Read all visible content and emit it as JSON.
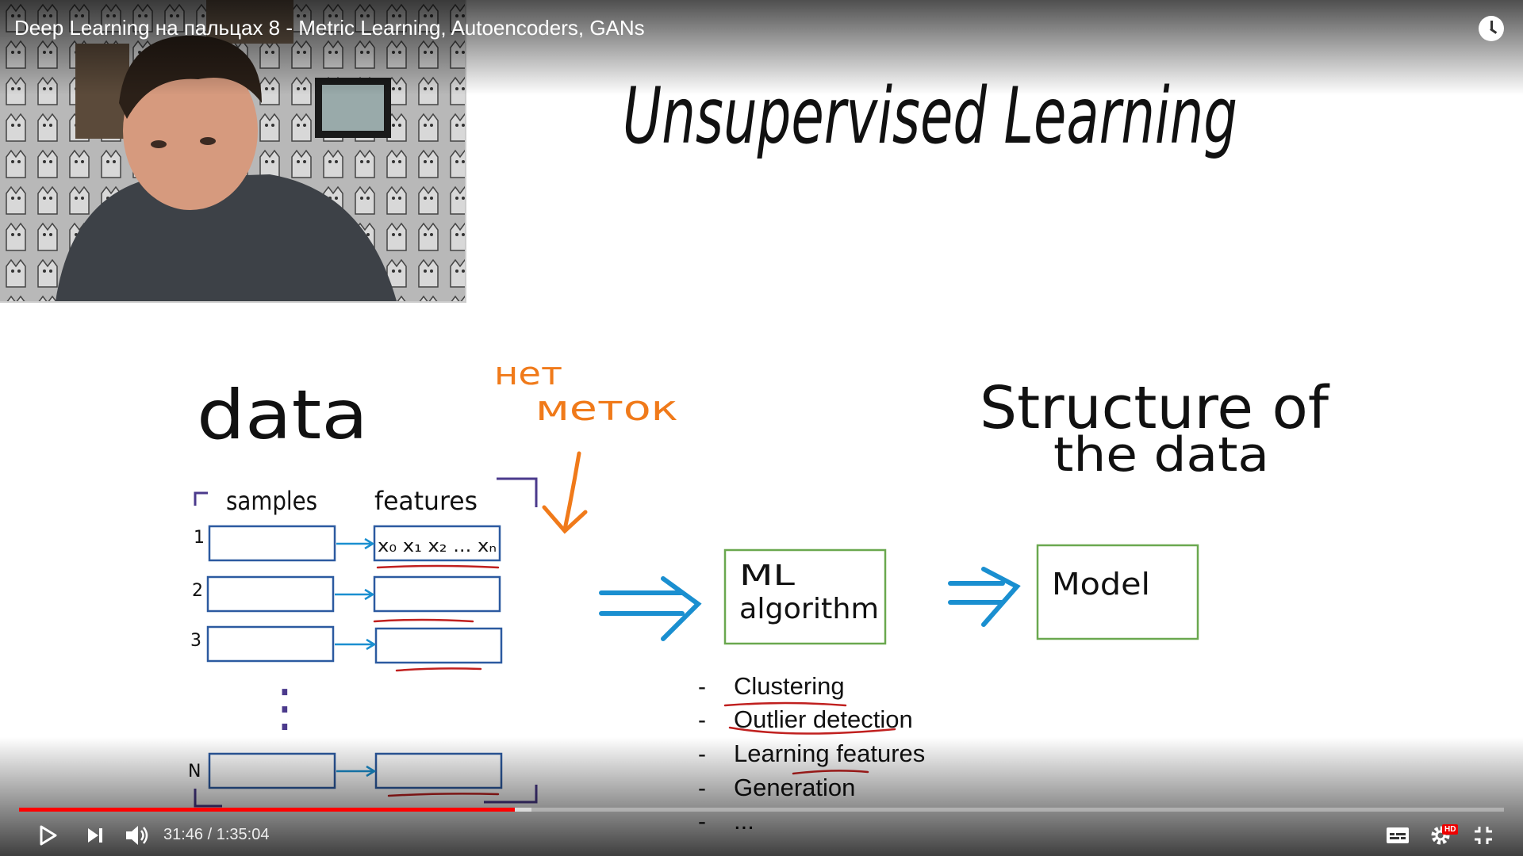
{
  "player": {
    "title": "Deep Learning на пальцах 8 - Metric Learning, Autoencoders, GANs",
    "current_time": "31:46",
    "duration": "1:35:04",
    "time_text": "31:46 / 1:35:04",
    "progress_fraction": 0.334,
    "buffered_fraction": 0.345,
    "hd_badge": "HD",
    "icons": [
      "play-icon",
      "next-icon",
      "volume-icon",
      "watch-later-icon",
      "subtitles-icon",
      "settings-icon",
      "exit-fullscreen-icon"
    ],
    "progress_color": "#ff0000"
  },
  "board": {
    "heading": "Unsupervised Learning",
    "data_label": "data",
    "no_labels_note_line1": "нет",
    "no_labels_note_line2": "меток",
    "samples_label": "samples",
    "features_label": "features",
    "row_labels": [
      "1",
      "2",
      "3",
      "N"
    ],
    "feature_vector": "x₀ x₁ x₂ ... xₙ",
    "vdots": "⋮",
    "ml_box_line1": "ML",
    "ml_box_line2": "algorithm",
    "model_box": "Model",
    "structure_line1": "Structure of",
    "structure_line2": "the data",
    "bullet_dash": "-",
    "tasks": [
      "Clustering",
      "Outlier detection",
      "Learning features",
      "Generation",
      "..."
    ],
    "colors": {
      "ink": "#111111",
      "blue": "#2c5aa0",
      "arrow_blue": "#1a8fd0",
      "orange": "#f07a1a",
      "red": "#c0201f",
      "green": "#6aa84f",
      "purple": "#4b3a8c"
    }
  }
}
